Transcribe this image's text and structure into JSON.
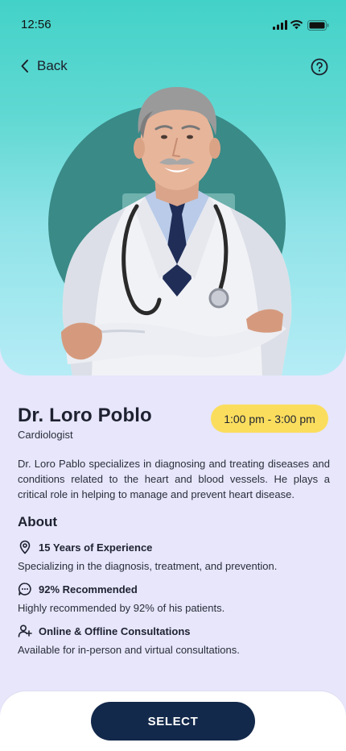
{
  "status_bar": {
    "time": "12:56"
  },
  "nav": {
    "back_label": "Back"
  },
  "doctor": {
    "name": "Dr. Loro Poblo",
    "specialty": "Cardiologist",
    "availability": "1:00 pm - 3:00 pm",
    "bio": "Dr. Loro Pablo specializes in diagnosing and treating diseases and conditions related to the heart and blood vessels. He plays a critical role in helping to manage and prevent heart disease."
  },
  "about": {
    "title": "About",
    "items": [
      {
        "icon": "location-pin-icon",
        "title": "15 Years of Experience",
        "description": "Specializing in the diagnosis, treatment, and prevention."
      },
      {
        "icon": "chat-bubble-icon",
        "title": "92% Recommended",
        "description": "Highly recommended by 92% of his patients."
      },
      {
        "icon": "user-plus-icon",
        "title": "Online & Offline Consultations",
        "description": "Available for in-person and virtual consultations."
      }
    ]
  },
  "actions": {
    "select_label": "SELECT"
  },
  "colors": {
    "hero_top": "#43d2c8",
    "hero_bottom": "#b6ecf6",
    "background": "#e7e6fb",
    "badge": "#fbdd5e",
    "button": "#13294b"
  }
}
